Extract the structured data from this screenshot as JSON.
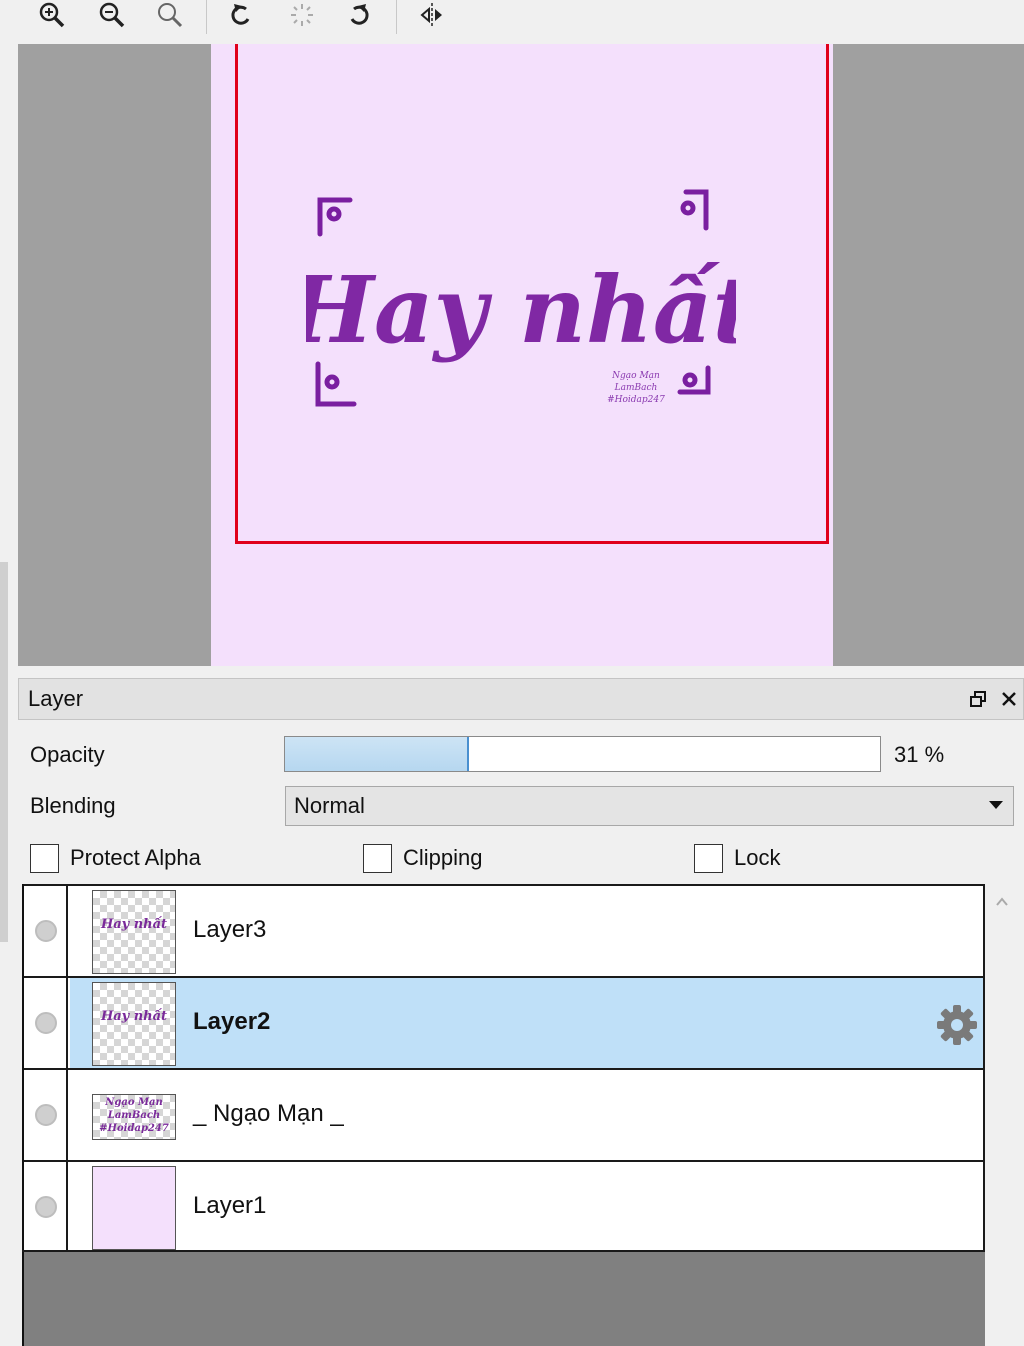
{
  "toolbar": {
    "buttons": [
      "zoom-in-icon",
      "zoom-out-icon",
      "zoom-reset-icon",
      "rotate-left-icon",
      "rotate-reset-icon",
      "rotate-right-icon",
      "flip-horizontal-icon"
    ]
  },
  "canvas": {
    "artwork_text": "Hay nhất",
    "signature_lines": [
      "Ngạo Mạn",
      "LamBach",
      "#Hoidap247"
    ],
    "colors": {
      "workspace": "#a0a0a0",
      "document": "#f4e0fc",
      "selection": "#e0001b",
      "ink": "#7a1fa0"
    }
  },
  "panel": {
    "title": "Layer",
    "opacity_label": "Opacity",
    "opacity_fraction": 0.31,
    "opacity_value": "31 %",
    "blending_label": "Blending",
    "blending_value": "Normal",
    "checkboxes": {
      "protect_alpha": "Protect Alpha",
      "clipping": "Clipping",
      "lock": "Lock"
    },
    "checkbox_states": {
      "protect_alpha": false,
      "clipping": false,
      "lock": false
    },
    "layers": [
      {
        "name": "Layer3",
        "selected": false,
        "thumb": "art"
      },
      {
        "name": "Layer2",
        "selected": true,
        "thumb": "art"
      },
      {
        "name": "_ Ngạo Mạn _",
        "selected": false,
        "thumb": "signature"
      },
      {
        "name": "Layer1",
        "selected": false,
        "thumb": "fill"
      }
    ]
  }
}
